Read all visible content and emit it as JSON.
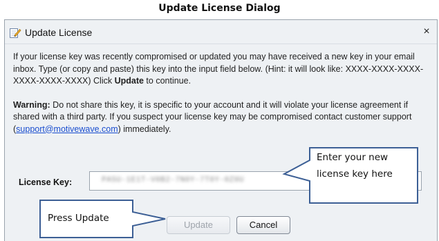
{
  "caption": "Update License Dialog",
  "dialog": {
    "title": "Update License",
    "close_glyph": "×",
    "icon": "pencil-document-icon",
    "intro": {
      "part1": "If your license key was recently compromised or updated you may have received a new key in your email inbox. Type (or copy and paste) this key into the input field below. (Hint: it will look like: XXXX-XXXX-XXXX-XXXX-XXXX-XXXX) Click ",
      "bold": "Update",
      "part2": " to continue."
    },
    "warning": {
      "label": "Warning:",
      "text1": " Do not share this key, it is specific to your account and it will violate your license agreement if shared with a third party. If you suspect your license key may be compromised contact customer support (",
      "email": "support@motivewave.com",
      "text2": ") immediately."
    },
    "license_key": {
      "label": "License Key:",
      "obscured_value": "PA5U-1E1T-V0B2-7N0Y-7T0Y-0Z0U"
    },
    "buttons": {
      "update": "Update",
      "cancel": "Cancel"
    }
  },
  "callouts": {
    "enter_key_line1": "Enter your new",
    "enter_key_line2": "license key here",
    "press_update": "Press Update"
  }
}
